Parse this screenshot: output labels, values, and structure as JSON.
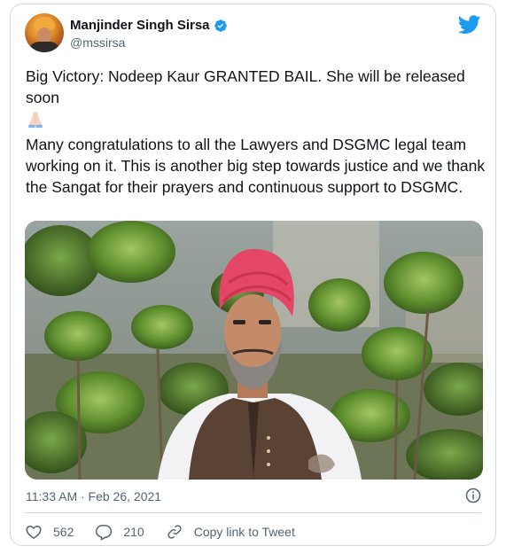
{
  "tweet": {
    "author": {
      "display_name": "Manjinder Singh Sirsa",
      "handle": "@mssirsa"
    },
    "text": {
      "line1": "Big Victory: Nodeep Kaur GRANTED BAIL. She will be released soon",
      "emoji": "🙏🏻",
      "line2": "Many congratulations  to all the Lawyers and DSGMC legal team working on it. This is another big step towards justice and we thank the Sangat for their prayers and continuous support to DSGMC."
    },
    "timestamp": "11:33 AM · Feb 26, 2021",
    "likes": "562",
    "replies": "210",
    "copy_link_label": "Copy link to Tweet"
  },
  "colors": {
    "brand_blue": "#1d9bf0",
    "like_red": "#f91880",
    "secondary_text": "#536471"
  },
  "icons": {
    "verified": "verified-badge-icon",
    "twitter": "twitter-bird-icon",
    "info": "info-icon",
    "like": "heart-icon",
    "reply": "reply-icon",
    "copy": "link-icon"
  }
}
